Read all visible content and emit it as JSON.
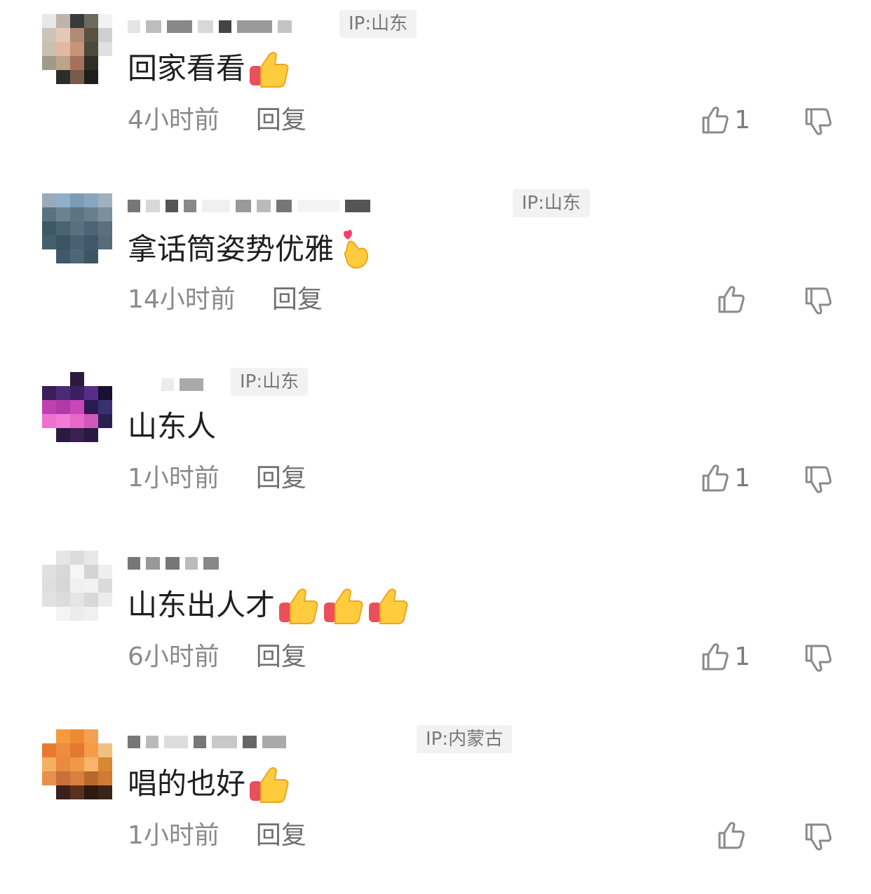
{
  "comments": [
    {
      "ip": "IP:山东",
      "text": "回家看看",
      "emoji_count": 1,
      "emoji": "thumbs-up-emoji",
      "time": "4小时前",
      "reply": "回复",
      "likes": "1"
    },
    {
      "ip": "IP:山东",
      "text": "拿话筒姿势优雅",
      "emoji_count": 1,
      "emoji": "finger-heart-emoji",
      "time": "14小时前",
      "reply": "回复",
      "likes": ""
    },
    {
      "ip": "IP:山东",
      "text": "山东人",
      "emoji_count": 0,
      "emoji": "",
      "time": "1小时前",
      "reply": "回复",
      "likes": "1"
    },
    {
      "ip": "",
      "text": "山东出人才",
      "emoji_count": 3,
      "emoji": "thumbs-up-emoji",
      "time": "6小时前",
      "reply": "回复",
      "likes": "1"
    },
    {
      "ip": "IP:内蒙古",
      "text": "唱的也好",
      "emoji_count": 1,
      "emoji": "thumbs-up-emoji",
      "time": "1小时前",
      "reply": "回复",
      "likes": ""
    }
  ],
  "colors": {
    "icon": "#8a8a8a",
    "ip_bg": "#f2f2f2",
    "text": "#1f1f1f",
    "meta": "#8a8a8a"
  }
}
